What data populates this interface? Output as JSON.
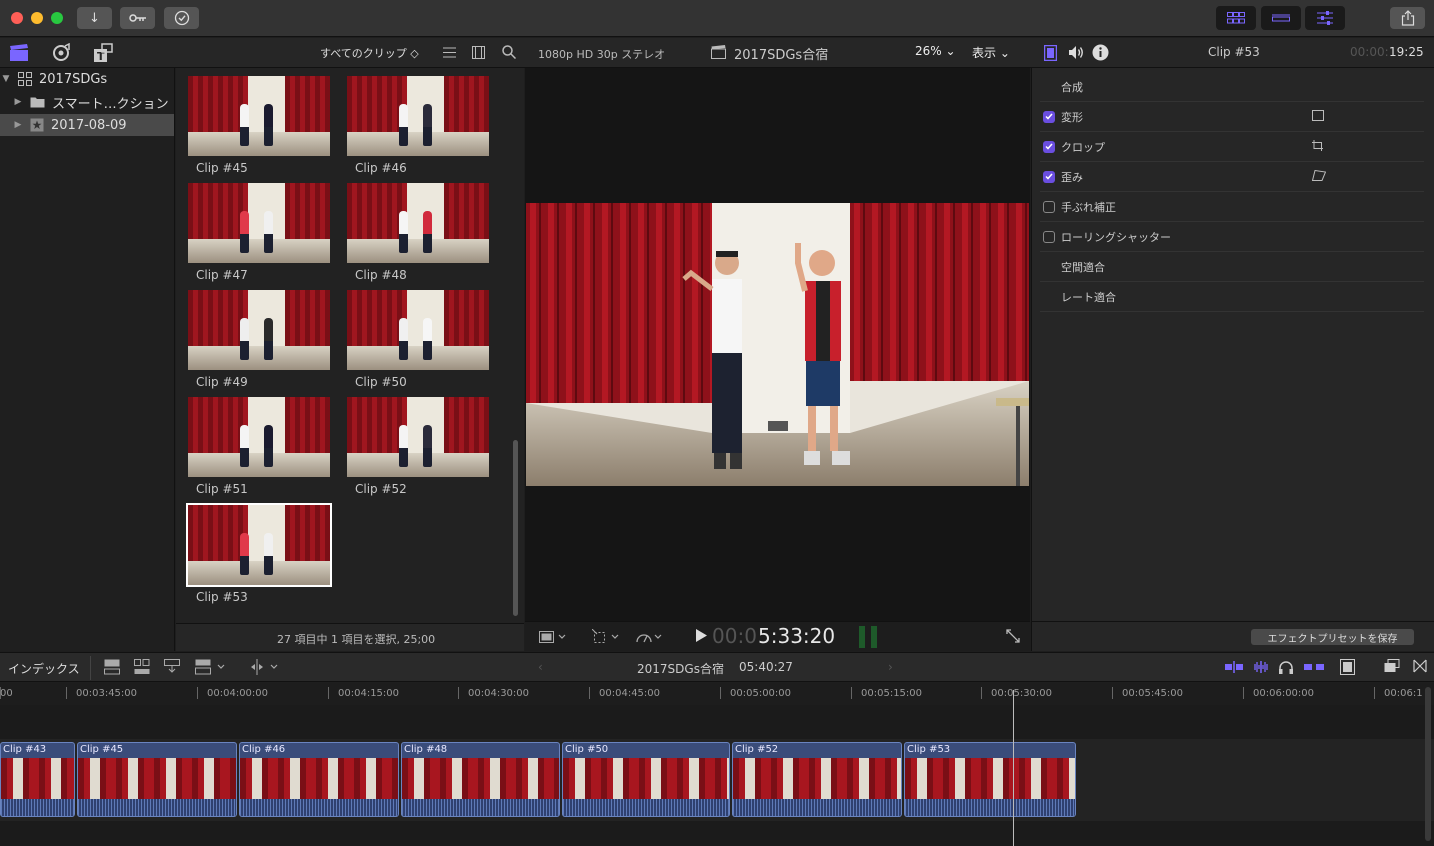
{
  "titlebar": {
    "traffic_lights": [
      "#ff5f57",
      "#febc2e",
      "#28c840"
    ],
    "icons": [
      "import-icon",
      "key-icon",
      "checkmark-icon"
    ],
    "right_icons": [
      "browser-layout-icon",
      "timeline-layout-icon",
      "inspector-layout-icon",
      "share-icon"
    ],
    "accent": "#6a4ee0"
  },
  "browser_toolbar": {
    "filter": "すべてのクリップ ◇",
    "format": "1080p HD 30p ステレオ",
    "project": "2017SDGs合宿",
    "zoom": "26% ⌄",
    "display": "表示 ⌄"
  },
  "sidebar": {
    "library": "2017SDGs",
    "items": [
      {
        "label": "スマート…クション"
      },
      {
        "label": "2017-08-09"
      }
    ]
  },
  "browser": {
    "clips": [
      {
        "label": "Clip #45"
      },
      {
        "label": "Clip #46"
      },
      {
        "label": "Clip #47"
      },
      {
        "label": "Clip #48"
      },
      {
        "label": "Clip #49"
      },
      {
        "label": "Clip #50"
      },
      {
        "label": "Clip #51"
      },
      {
        "label": "Clip #52"
      },
      {
        "label": "Clip #53"
      }
    ],
    "status": "27 項目中 1 項目を選択, 25;00"
  },
  "viewer": {
    "timecode_dim": "00:0",
    "timecode": "5:33:20"
  },
  "inspector": {
    "clip_name": "Clip #53",
    "duration_dim": "00:00:",
    "duration": "19:25",
    "rows": [
      {
        "label": "合成",
        "check": "none"
      },
      {
        "label": "変形",
        "check": "on"
      },
      {
        "label": "クロップ",
        "check": "on"
      },
      {
        "label": "歪み",
        "check": "on"
      },
      {
        "label": "手ぶれ補正",
        "check": "off"
      },
      {
        "label": "ローリングシャッター",
        "check": "off"
      },
      {
        "label": "空間適合",
        "check": "none"
      },
      {
        "label": "レート適合",
        "check": "none"
      }
    ],
    "save_preset": "エフェクトプリセットを保存"
  },
  "timeline": {
    "index": "インデックス",
    "project": "2017SDGs合宿",
    "duration": "05:40:27",
    "ruler": [
      "00",
      "00:03:45:00",
      "00:04:00:00",
      "00:04:15:00",
      "00:04:30:00",
      "00:04:45:00",
      "00:05:00:00",
      "00:05:15:00",
      "00:05:30:00",
      "00:05:45:00",
      "00:06:00:00",
      "00:06:1"
    ],
    "clips": [
      {
        "label": "Clip #43"
      },
      {
        "label": "Clip #45"
      },
      {
        "label": "Clip #46"
      },
      {
        "label": "Clip #48"
      },
      {
        "label": "Clip #50"
      },
      {
        "label": "Clip #52"
      },
      {
        "label": "Clip #53"
      }
    ]
  }
}
